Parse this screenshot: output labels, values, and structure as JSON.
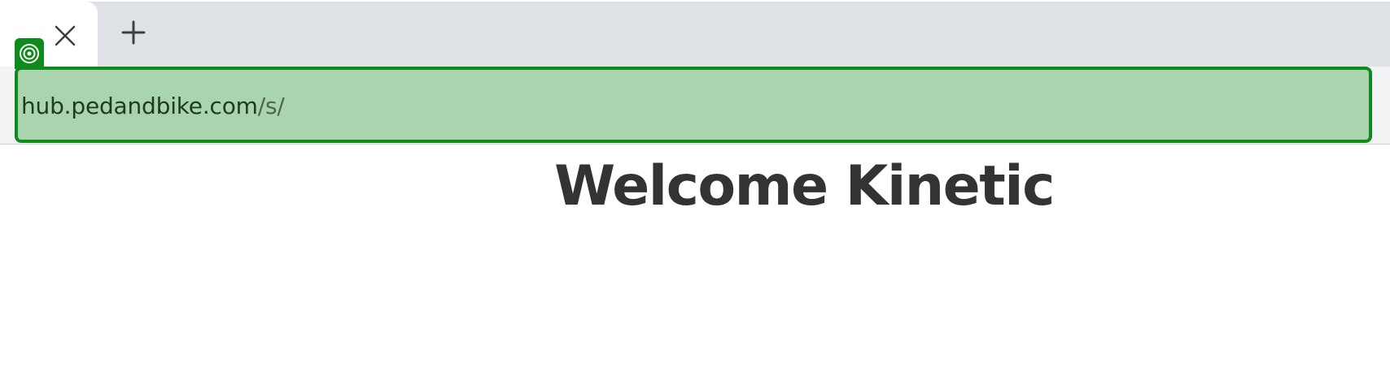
{
  "browser": {
    "tabs": [
      {
        "close_icon": "close-icon",
        "favicon": "target-icon"
      }
    ],
    "new_tab_icon": "plus-icon",
    "omnibox": {
      "host": "hub.pedandbike.com",
      "path": "/s/",
      "highlight_color": "#aad4ae",
      "border_color": "#0f8a1c"
    }
  },
  "page": {
    "heading": "Welcome Kinetic"
  },
  "colors": {
    "tab_strip": "#dee1e6",
    "toolbar": "#f1f3f4",
    "accent_green": "#0f8a1c",
    "heading_text": "#333333"
  }
}
